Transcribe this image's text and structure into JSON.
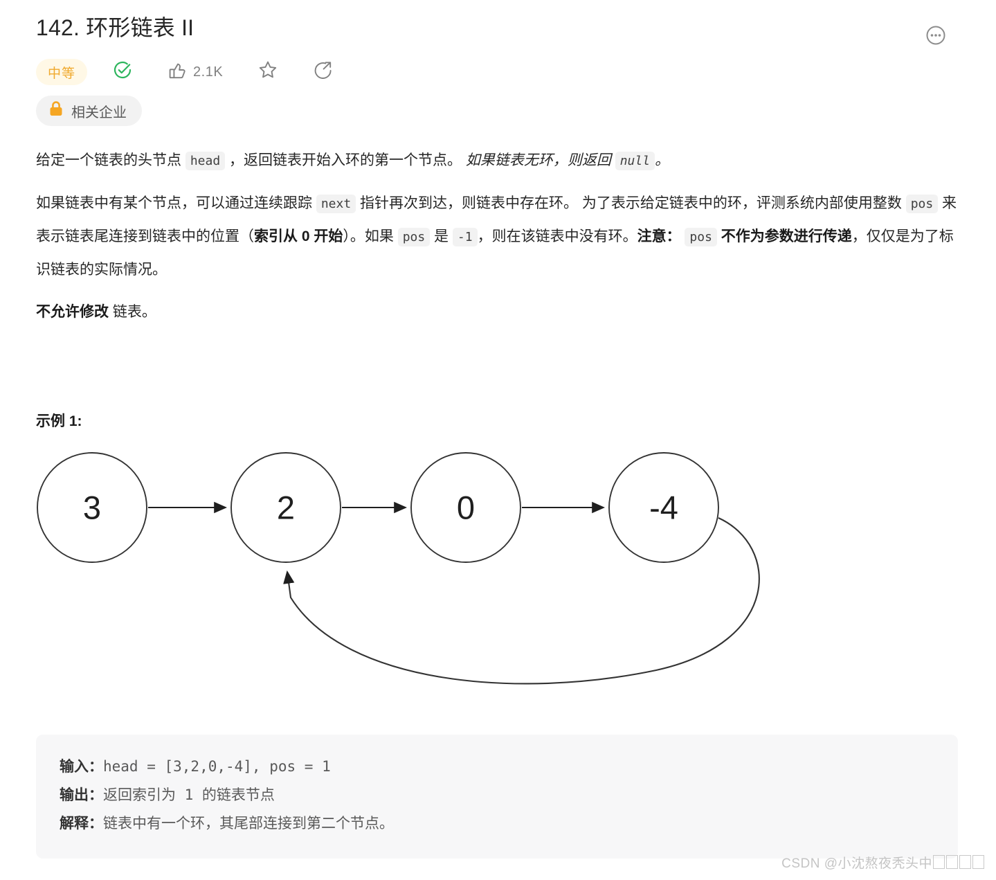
{
  "header": {
    "title": "142. 环形链表 II",
    "more_icon": "ellipsis-circle-icon"
  },
  "meta": {
    "difficulty": "中等",
    "difficulty_color": "#f0a92d",
    "difficulty_bg": "#fff8e6",
    "solved_icon": "check-circle-icon",
    "solved_color": "#2db55d",
    "like_icon": "thumbs-up-icon",
    "like_count": "2.1K",
    "favorite_icon": "star-icon",
    "share_icon": "share-icon"
  },
  "company": {
    "lock_icon": "lock-icon",
    "lock_color": "#f5a623",
    "label": "相关企业"
  },
  "description": {
    "p1": {
      "t1": "给定一个链表的头节点 ",
      "code1": "head",
      "t2": " ，返回链表开始入环的第一个节点。 ",
      "em1": "如果链表无环，则返回 ",
      "em_code": "null",
      "em2": "。"
    },
    "p2": {
      "t1": "如果链表中有某个节点，可以通过连续跟踪 ",
      "code1": "next",
      "t2": " 指针再次到达，则链表中存在环。 为了表示给定链表中的环，评测系统内部使用整数 ",
      "code2": "pos",
      "t3": " 来表示链表尾连接到链表中的位置（",
      "b1": "索引从 0 开始",
      "t4": "）。如果 ",
      "code3": "pos",
      "t5": " 是 ",
      "code4": "-1",
      "t6": "，则在该链表中没有环。",
      "b2": "注意：",
      "t7": " ",
      "code5": "pos",
      "b3": " 不作为参数进行传递",
      "t8": "，仅仅是为了标识链表的实际情况。"
    },
    "p3": {
      "b1": "不允许修改",
      "t1": " 链表。"
    }
  },
  "example": {
    "heading": "示例 1:",
    "diagram": {
      "type": "linked-list-cycle",
      "nodes": [
        "3",
        "2",
        "0",
        "-4"
      ],
      "cycle_from_index": 3,
      "cycle_to_index": 1,
      "node_radius": 79,
      "stroke_color": "#333333",
      "fill_color": "#ffffff"
    },
    "io": {
      "input_label": "输入：",
      "input_value": "head = [3,2,0,-4], pos = 1",
      "output_label": "输出：",
      "output_value": "返回索引为 1 的链表节点",
      "explain_label": "解释：",
      "explain_value": "链表中有一个环，其尾部连接到第二个节点。"
    }
  },
  "watermark": {
    "prefix": "CSDN @小沈熬夜秃头中"
  }
}
